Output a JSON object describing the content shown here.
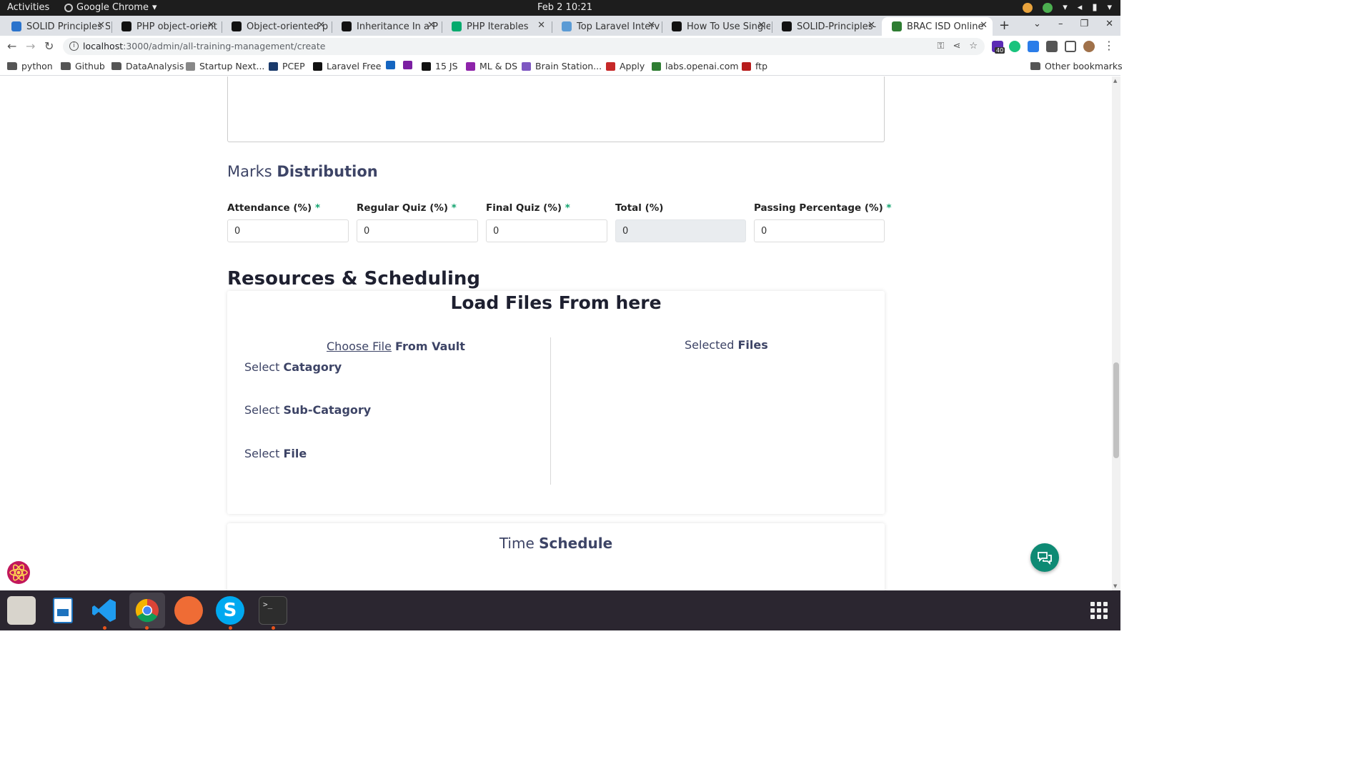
{
  "os": {
    "activities": "Activities",
    "app_name": "Google Chrome",
    "clock": "Feb 2  10:21"
  },
  "browser": {
    "tabs": [
      {
        "title": "SOLID Principles S",
        "favicon": "coursera-icon",
        "color": "#2a73cc"
      },
      {
        "title": "PHP object-orient",
        "favicon": "medium-icon",
        "color": "#111111"
      },
      {
        "title": "Object-oriented p",
        "favicon": "medium-icon",
        "color": "#111111"
      },
      {
        "title": "Inheritance In a P",
        "favicon": "medium-icon",
        "color": "#111111"
      },
      {
        "title": "PHP Iterables",
        "favicon": "w3schools-icon",
        "color": "#04aa6d"
      },
      {
        "title": "Top Laravel Interv",
        "favicon": "chart-icon",
        "color": "#5b9bd5"
      },
      {
        "title": "How To Use Single",
        "favicon": "medium-icon",
        "color": "#111111"
      },
      {
        "title": "SOLID-Principles-",
        "favicon": "github-icon",
        "color": "#111111"
      },
      {
        "title": "BRAC ISD Online",
        "favicon": "brac-icon",
        "color": "#2e7d32",
        "active": true
      }
    ],
    "url_host": "localhost",
    "url_path": ":3000/admin/all-training-management/create",
    "extension_badge": "40",
    "bookmarks": [
      {
        "label": "python",
        "icon": "folder-icon"
      },
      {
        "label": "Github",
        "icon": "folder-icon"
      },
      {
        "label": "DataAnalysis",
        "icon": "folder-icon"
      },
      {
        "label": "Startup Next...",
        "icon": "startup-icon"
      },
      {
        "label": "PCEP",
        "icon": "pcep-icon"
      },
      {
        "label": "Laravel Free",
        "icon": "dev-icon"
      },
      {
        "label": "",
        "icon": "k-icon"
      },
      {
        "label": "",
        "icon": "bracket-icon"
      },
      {
        "label": "15 JS",
        "icon": "medium-icon"
      },
      {
        "label": "ML & DS",
        "icon": "info-icon"
      },
      {
        "label": "Brain Station...",
        "icon": "search-icon"
      },
      {
        "label": "Apply",
        "icon": "seu-icon"
      },
      {
        "label": "labs.openai.com",
        "icon": "openai-icon"
      },
      {
        "label": "ftp",
        "icon": "w-icon"
      }
    ],
    "other_bookmarks": "Other bookmarks"
  },
  "page": {
    "marks_title_light": "Marks",
    "marks_title_bold": "Distribution",
    "fields": [
      {
        "label": "Attendance (%)",
        "required": "*",
        "value": "0",
        "readonly": false
      },
      {
        "label": "Regular Quiz (%)",
        "required": "*",
        "value": "0",
        "readonly": false
      },
      {
        "label": "Final Quiz (%)",
        "required": "*",
        "value": "0",
        "readonly": false
      },
      {
        "label": "Total (%)",
        "required": "",
        "value": "0",
        "readonly": true
      },
      {
        "label": "Passing Percentage (%)",
        "required": "*",
        "value": "0",
        "readonly": false
      }
    ],
    "resources_title": "Resources & Scheduling",
    "load_files_title": "Load Files From here",
    "choose_file": "Choose File",
    "from_vault": "From Vault",
    "selects": [
      {
        "light": "Select",
        "bold": "Catagory"
      },
      {
        "light": "Select",
        "bold": "Sub-Catagory"
      },
      {
        "light": "Select",
        "bold": "File"
      }
    ],
    "selected_light": "Selected",
    "selected_bold": "Files",
    "time_light": "Time",
    "time_bold": "Schedule"
  },
  "colors": {
    "accent_text": "#3d4466",
    "required": "#11a36e",
    "chat_button": "#0e8a74"
  }
}
